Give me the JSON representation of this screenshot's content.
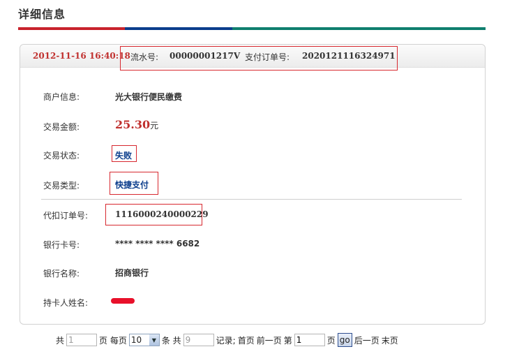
{
  "page": {
    "title": "详细信息"
  },
  "colors": {
    "accent_red": "#c8232c",
    "accent_blue": "#0b3d8c",
    "accent_teal": "#0f7f6e"
  },
  "header": {
    "time": "2012-11-16 16:40:18",
    "serial_label": "流水号:",
    "serial_value": "00000001217V",
    "payorder_label": "支付订单号:",
    "payorder_value": "2020121116324971"
  },
  "details": {
    "merchant_label": "商户信息:",
    "merchant_value": "光大银行便民缴费",
    "amount_label": "交易金额:",
    "amount_value": "25.30",
    "amount_unit": "元",
    "status_label": "交易状态:",
    "status_value": "失败",
    "type_label": "交易类型:",
    "type_value": "快捷支付",
    "agent_order_label": "代扣订单号:",
    "agent_order_value": "1116000240000229",
    "card_label": "银行卡号:",
    "card_value": "**** **** **** 6682",
    "bank_label": "银行名称:",
    "bank_value": "招商银行",
    "holder_label": "持卡人姓名:"
  },
  "pagination": {
    "total_prefix": "共",
    "total_pages": "1",
    "pages_unit": "页 每页",
    "per_page": "10",
    "per_page_unit": "条 共",
    "total_records": "9",
    "records_text": "记录;",
    "first": "首页",
    "prev": "前一页",
    "goto_prefix": "第",
    "goto_page": "1",
    "goto_suffix": "页",
    "go": "go",
    "next": "后一页",
    "last": "末页"
  }
}
